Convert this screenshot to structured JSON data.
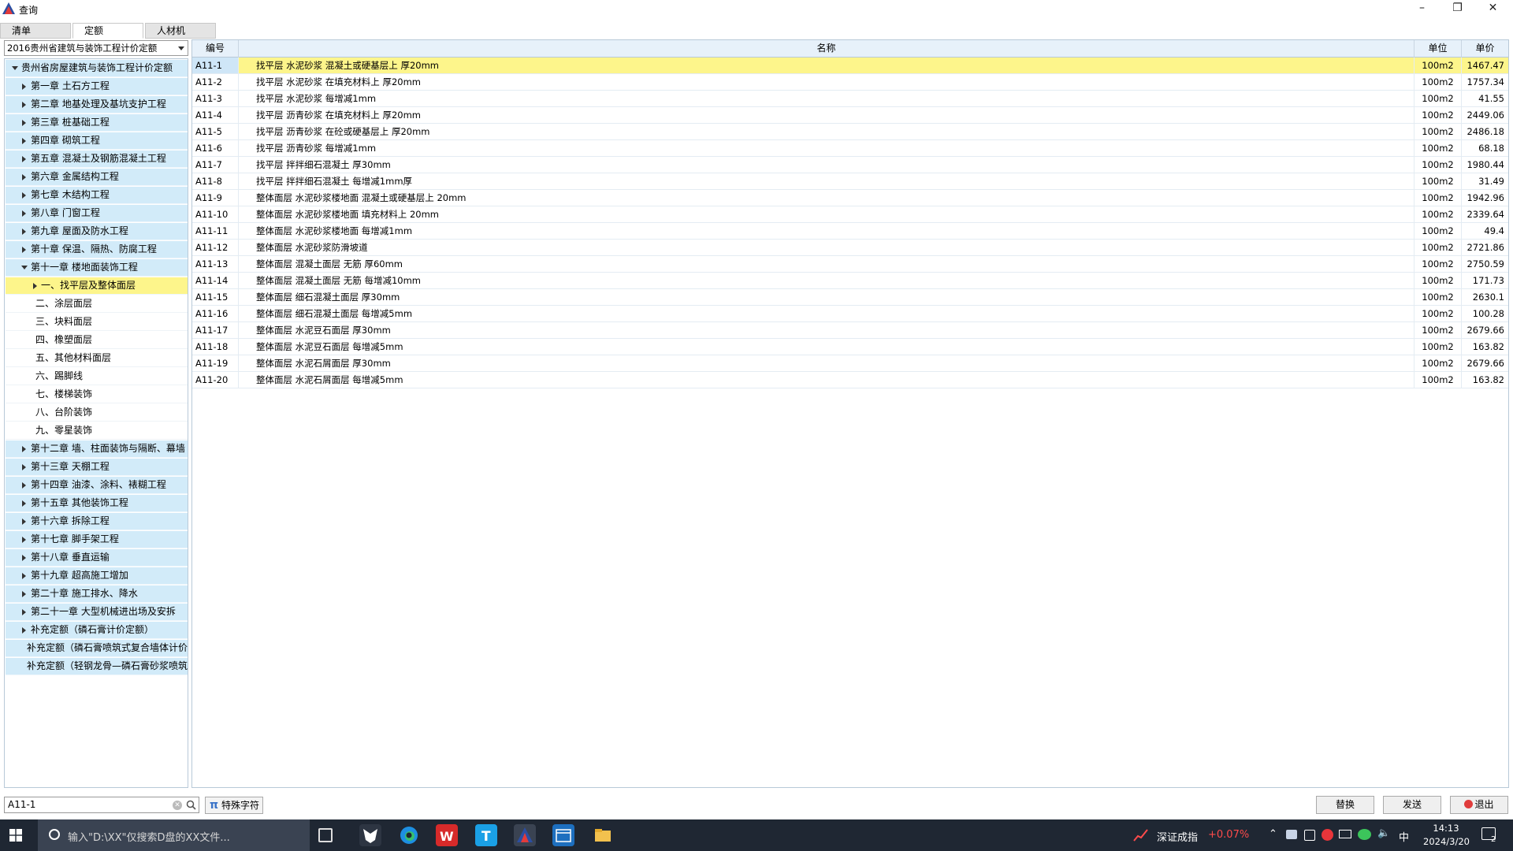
{
  "window": {
    "title": "查询",
    "min_label": "–",
    "max_label": "❐",
    "close_label": "✕"
  },
  "tabs": [
    {
      "label": "清单"
    },
    {
      "label": "定额"
    },
    {
      "label": "人材机"
    }
  ],
  "quota_db": {
    "selected": "2016贵州省建筑与装饰工程计价定额"
  },
  "tree": {
    "root": "贵州省房屋建筑与装饰工程计价定额",
    "chapters": [
      "第一章 土石方工程",
      "第二章 地基处理及基坑支护工程",
      "第三章 桩基础工程",
      "第四章 砌筑工程",
      "第五章 混凝土及钢筋混凝土工程",
      "第六章 金属结构工程",
      "第七章 木结构工程",
      "第八章 门窗工程",
      "第九章 屋面及防水工程",
      "第十章 保温、隔热、防腐工程"
    ],
    "chapter11": "第十一章 楼地面装饰工程",
    "chapter11_children": [
      "一、找平层及整体面层",
      "二、涂层面层",
      "三、块料面层",
      "四、橡塑面层",
      "五、其他材料面层",
      "六、踢脚线",
      "七、楼梯装饰",
      "八、台阶装饰",
      "九、零星装饰"
    ],
    "chapters_after": [
      "第十二章 墙、柱面装饰与隔断、幕墙",
      "第十三章 天棚工程",
      "第十四章 油漆、涂料、裱糊工程",
      "第十五章 其他装饰工程",
      "第十六章 拆除工程",
      "第十七章 脚手架工程",
      "第十八章 垂直运输",
      "第十九章 超高施工增加",
      "第二十章 施工排水、降水",
      "第二十一章 大型机械进出场及安拆",
      "补充定额（磷石膏计价定额）"
    ],
    "supplements": [
      "补充定额（磷石膏喷筑式复合墙体计价",
      "补充定额（轻钢龙骨—磷石膏砂浆喷筑"
    ]
  },
  "grid": {
    "headers": {
      "code": "编号",
      "name": "名称",
      "unit": "单位",
      "price": "单价"
    },
    "rows": [
      {
        "code": "A11-1",
        "name": "找平层 水泥砂浆 混凝土或硬基层上 厚20mm",
        "unit": "100m2",
        "price": "1467.47"
      },
      {
        "code": "A11-2",
        "name": "找平层 水泥砂浆 在填充材料上 厚20mm",
        "unit": "100m2",
        "price": "1757.34"
      },
      {
        "code": "A11-3",
        "name": "找平层 水泥砂浆 每增减1mm",
        "unit": "100m2",
        "price": "41.55"
      },
      {
        "code": "A11-4",
        "name": "找平层 沥青砂浆 在填充材料上 厚20mm",
        "unit": "100m2",
        "price": "2449.06"
      },
      {
        "code": "A11-5",
        "name": "找平层 沥青砂浆 在砼或硬基层上 厚20mm",
        "unit": "100m2",
        "price": "2486.18"
      },
      {
        "code": "A11-6",
        "name": "找平层 沥青砂浆 每增减1mm",
        "unit": "100m2",
        "price": "68.18"
      },
      {
        "code": "A11-7",
        "name": "找平层 拌拌细石混凝土 厚30mm",
        "unit": "100m2",
        "price": "1980.44"
      },
      {
        "code": "A11-8",
        "name": "找平层 拌拌细石混凝土 每增减1mm厚",
        "unit": "100m2",
        "price": "31.49"
      },
      {
        "code": "A11-9",
        "name": "整体面层 水泥砂浆楼地面 混凝土或硬基层上 20mm",
        "unit": "100m2",
        "price": "1942.96"
      },
      {
        "code": "A11-10",
        "name": "整体面层 水泥砂浆楼地面 填充材料上 20mm",
        "unit": "100m2",
        "price": "2339.64"
      },
      {
        "code": "A11-11",
        "name": "整体面层 水泥砂浆楼地面 每增减1mm",
        "unit": "100m2",
        "price": "49.4"
      },
      {
        "code": "A11-12",
        "name": "整体面层 水泥砂浆防滑坡道",
        "unit": "100m2",
        "price": "2721.86"
      },
      {
        "code": "A11-13",
        "name": "整体面层 混凝土面层 无筋 厚60mm",
        "unit": "100m2",
        "price": "2750.59"
      },
      {
        "code": "A11-14",
        "name": "整体面层 混凝土面层 无筋 每增减10mm",
        "unit": "100m2",
        "price": "171.73"
      },
      {
        "code": "A11-15",
        "name": "整体面层 细石混凝土面层 厚30mm",
        "unit": "100m2",
        "price": "2630.1"
      },
      {
        "code": "A11-16",
        "name": "整体面层 细石混凝土面层 每增减5mm",
        "unit": "100m2",
        "price": "100.28"
      },
      {
        "code": "A11-17",
        "name": "整体面层 水泥豆石面层 厚30mm",
        "unit": "100m2",
        "price": "2679.66"
      },
      {
        "code": "A11-18",
        "name": "整体面层 水泥豆石面层 每增减5mm",
        "unit": "100m2",
        "price": "163.82"
      },
      {
        "code": "A11-19",
        "name": "整体面层 水泥石屑面层 厚30mm",
        "unit": "100m2",
        "price": "2679.66"
      },
      {
        "code": "A11-20",
        "name": "整体面层 水泥石屑面层 每增减5mm",
        "unit": "100m2",
        "price": "163.82"
      }
    ]
  },
  "search": {
    "value": "A11-1"
  },
  "buttons": {
    "special": "特殊字符",
    "replace": "替换",
    "send": "发送",
    "exit": "退出"
  },
  "taskbar": {
    "search_placeholder": "输入\"D:\\XX\"仅搜索D盘的XX文件...",
    "stock_name": "深证成指",
    "stock_change": "+0.07%",
    "ime": "中",
    "time": "14:13",
    "date": "2024/3/20",
    "notification_count": "2"
  },
  "colors": {
    "selection": "#fdf58b",
    "tree_node_bg": "#d2ebf9",
    "header_bg": "#e7f1fa",
    "taskbar_bg": "#1f2733",
    "stock_up": "#ff4b4b"
  }
}
